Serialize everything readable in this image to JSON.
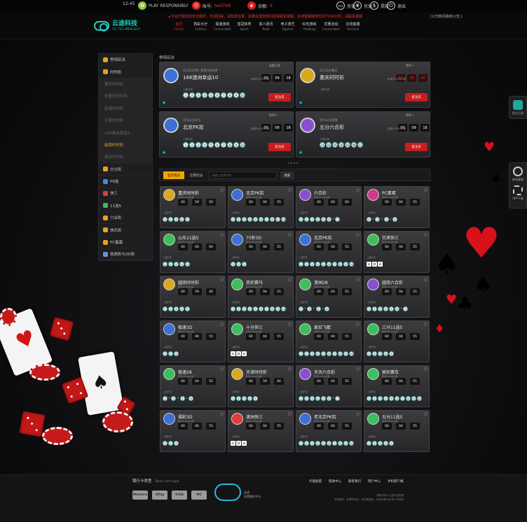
{
  "topbar": {
    "time": "12:45",
    "responsible": "PLAY RESPONSIBLY",
    "account_label": "账号:",
    "account_value": "test768",
    "balance_label": "余额:",
    "balance_value": "0",
    "actions": [
      "充值卡",
      "充值",
      "提款",
      "退出"
    ]
  },
  "header": {
    "marquee": "平台已经改善优化服务，欢迎回来，请玩家注意，如果充值发现问题请联系客服。在线客服服务时间7X24小时，请联系客服",
    "marquee_extra": "[公司新闻最新公告 ]",
    "logo_text": "云途科技",
    "logo_sub": "YG.TECHNOLOGY",
    "nav": [
      {
        "cn": "首页",
        "en": "Home"
      },
      {
        "cn": "购彩大厅",
        "en": "Lottery"
      },
      {
        "cn": "极速游戏",
        "en": "Favourable"
      },
      {
        "cn": "皇冠体育",
        "en": "Sport"
      },
      {
        "cn": "真人视讯",
        "en": "Real"
      },
      {
        "cn": "电子游艺",
        "en": "Egame"
      },
      {
        "cn": "红包游戏",
        "en": "Redbag"
      },
      {
        "cn": "优惠活动",
        "en": "Favourable"
      },
      {
        "cn": "在线客服",
        "en": "Service"
      }
    ]
  },
  "sidebar": {
    "items": [
      {
        "label": "常用玩法",
        "kind": "main",
        "color": "#e8a419"
      },
      {
        "label": "时时彩",
        "kind": "main",
        "color": "#e8a419"
      },
      {
        "label": "重庆时时彩",
        "kind": "sub"
      },
      {
        "label": "老重庆时时彩",
        "kind": "sub"
      },
      {
        "label": "新疆时时彩",
        "kind": "sub"
      },
      {
        "label": "天津时时彩",
        "kind": "sub"
      },
      {
        "label": "168澳洲幸运5",
        "kind": "sub"
      },
      {
        "label": "越南时时彩",
        "kind": "sub-active"
      },
      {
        "label": "澳洲时时彩",
        "kind": "sub"
      },
      {
        "label": "分分彩",
        "kind": "main",
        "color": "#e8a419"
      },
      {
        "label": "PK拾",
        "kind": "main",
        "color": "#3b8de0"
      },
      {
        "label": "快三",
        "kind": "main",
        "color": "#e23b3b"
      },
      {
        "label": "11选5",
        "kind": "main",
        "color": "#3bbf5a"
      },
      {
        "label": "六合彩",
        "kind": "main",
        "color": "#e8a419"
      },
      {
        "label": "快乐彩",
        "kind": "main",
        "color": "#e8a419"
      },
      {
        "label": "PC蛋蛋",
        "kind": "main",
        "color": "#e8a419"
      },
      {
        "label": "低频彩与3D彩",
        "kind": "main",
        "color": "#6b8fe0"
      }
    ]
  },
  "featured": {
    "title": "常用玩法",
    "cards": [
      {
        "sub": "官方玩法/第三期是开奖结果",
        "name": "168澳洲幸运10",
        "period": "上期开奖",
        "issue": "距离0000000期",
        "timer": [
          "00",
          "09",
          "18"
        ],
        "timer_red": false,
        "balls": [
          "1",
          "2",
          "3",
          "4",
          "5",
          "6",
          "7",
          "8",
          "9",
          "10"
        ],
        "sound": "无提示音",
        "bet": "投注去",
        "color": "#3c6fd8"
      },
      {
        "sub": "官方玩法/整点",
        "name": "重庆时时彩",
        "period": "上期开奖",
        "issue": "距离0000000期",
        "timer": [
          "00",
          "00",
          "00"
        ],
        "timer_red": true,
        "balls": [],
        "sound": "铃声一",
        "bet": "投注去",
        "color": "#d8a91c"
      },
      {
        "sub": "官方玩法/北京",
        "name": "北京PK拾",
        "period": "上期开奖",
        "issue": "距离0000000期",
        "timer": [
          "00",
          "09",
          "18"
        ],
        "timer_red": false,
        "balls": [
          "1",
          "2",
          "3",
          "4",
          "5",
          "6",
          "7",
          "8",
          "9",
          "10"
        ],
        "sound": "铃声二",
        "bet": "投注去",
        "color": "#3c6fd8"
      },
      {
        "sub": "官方玩法/香港",
        "name": "五分六合彩",
        "period": "上期开奖",
        "issue": "距离0000000期",
        "timer": [
          "00",
          "09",
          "18"
        ],
        "timer_red": false,
        "balls": [
          "31",
          "43",
          "05",
          "30",
          "03",
          "46",
          "13"
        ],
        "sound": "铃声一",
        "bet": "投注去",
        "color": "#8a4fd0"
      }
    ]
  },
  "tabs": {
    "official": "官方玩法",
    "credit": "信用玩法",
    "search_placeholder": "请输入彩票名称",
    "search_button": "搜索"
  },
  "games": [
    {
      "name": "重庆时时彩",
      "color": "#d8a91c",
      "t": [
        "40",
        "59",
        "50"
      ],
      "b": [
        "1",
        "2",
        "3",
        "4",
        "5"
      ],
      "type": "ball"
    },
    {
      "name": "北京PK拾",
      "color": "#3c6fd8",
      "t": [
        "00",
        "06",
        "55"
      ],
      "b": [
        "1",
        "2",
        "3",
        "4",
        "5",
        "6",
        "7",
        "8",
        "9",
        "10"
      ],
      "type": "ball"
    },
    {
      "name": "六合彩",
      "color": "#8a4fd0",
      "t": [
        "00",
        "00",
        "00"
      ],
      "b": [
        "1",
        "2",
        "3",
        "4",
        "5",
        "6",
        "+",
        "7"
      ],
      "type": "ball"
    },
    {
      "name": "PC蛋蛋",
      "color": "#cc3b8a",
      "t": [
        "00",
        "04",
        "55"
      ],
      "b": [
        "1",
        "+",
        "2",
        "+",
        "3",
        "=",
        "6"
      ],
      "type": "ball"
    },
    {
      "name": "山东11选5",
      "color": "#3bbf5a",
      "t": [
        "00",
        "00",
        "00"
      ],
      "b": [
        "1",
        "2",
        "3",
        "4",
        "5"
      ],
      "type": "ball"
    },
    {
      "name": "75秒3D",
      "color": "#3c6fd8",
      "t": [
        "00",
        "00",
        "55"
      ],
      "b": [
        "1",
        "2",
        "3"
      ],
      "type": "ball"
    },
    {
      "name": "北京PK拾",
      "color": "#3c6fd8",
      "t": [
        "00",
        "04",
        "55"
      ],
      "b": [
        "1",
        "2",
        "3",
        "4",
        "5",
        "6",
        "7",
        "8",
        "9",
        "10"
      ],
      "type": "ball"
    },
    {
      "name": "甘肃快三",
      "color": "#3bbf5a",
      "t": [
        "00",
        "04",
        "55"
      ],
      "b": [
        "⚀",
        "⚁",
        "⚂"
      ],
      "type": "dice"
    },
    {
      "name": "越南时时彩",
      "color": "#d8a91c",
      "t": [
        "00",
        "59",
        "40"
      ],
      "b": [
        "1",
        "2",
        "3",
        "4",
        "5"
      ],
      "type": "ball"
    },
    {
      "name": "英伦赛马",
      "color": "#3bbf5a",
      "t": [
        "00",
        "04",
        "55"
      ],
      "b": [
        "1",
        "2",
        "3",
        "4",
        "5",
        "6",
        "7",
        "8",
        "9",
        "10"
      ],
      "type": "ball"
    },
    {
      "name": "澳洲28",
      "color": "#3bbf5a",
      "t": [
        "00",
        "04",
        "55"
      ],
      "b": [
        "1",
        "+",
        "2",
        "+",
        "3",
        "=",
        "6"
      ],
      "type": "ball"
    },
    {
      "name": "越南六合彩",
      "color": "#8a4fd0",
      "t": [
        "00",
        "04",
        "55"
      ],
      "b": [
        "1",
        "2",
        "3",
        "4",
        "5",
        "6",
        "+",
        "7"
      ],
      "type": "ball"
    },
    {
      "name": "极速3D",
      "color": "#3c6fd8",
      "t": [
        "00",
        "06",
        "55"
      ],
      "b": [
        "1",
        "2",
        "3"
      ],
      "type": "ball"
    },
    {
      "name": "十分快三",
      "color": "#3bbf5a",
      "t": [
        "00",
        "04",
        "55"
      ],
      "b": [
        "⚀",
        "⚁",
        "⚂"
      ],
      "type": "dice"
    },
    {
      "name": "疯狂飞艇",
      "color": "#3bbf5a",
      "t": [
        "00",
        "04",
        "55"
      ],
      "b": [
        "1",
        "2",
        "3",
        "4",
        "5",
        "6",
        "7",
        "8",
        "9",
        "10"
      ],
      "type": "ball"
    },
    {
      "name": "三分11选5",
      "color": "#3bbf5a",
      "t": [
        "00",
        "04",
        "55"
      ],
      "b": [
        "1",
        "2",
        "3",
        "4",
        "5"
      ],
      "type": "ball"
    },
    {
      "name": "极速28",
      "color": "#3bbf5a",
      "t": [
        "00",
        "04",
        "55"
      ],
      "b": [
        "1",
        "+",
        "2",
        "+",
        "3",
        "=",
        "6"
      ],
      "type": "ball"
    },
    {
      "name": "天津时时彩",
      "color": "#d8a91c",
      "t": [
        "00",
        "59",
        "40"
      ],
      "b": [
        "1",
        "2",
        "3",
        "4",
        "5"
      ],
      "type": "ball"
    },
    {
      "name": "天天六合彩",
      "color": "#8a4fd0",
      "t": [
        "00",
        "04",
        "55"
      ],
      "b": [
        "1",
        "2",
        "3",
        "4",
        "5",
        "6",
        "+",
        "7"
      ],
      "type": "ball"
    },
    {
      "name": "疯狂赛车",
      "color": "#3bbf5a",
      "t": [
        "00",
        "04",
        "55"
      ],
      "b": [
        "1",
        "2",
        "3",
        "4",
        "5",
        "6",
        "7",
        "8",
        "9",
        "10"
      ],
      "type": "ball"
    },
    {
      "name": "福彩3D",
      "color": "#3c6fd8",
      "t": [
        "00",
        "06",
        "55"
      ],
      "b": [
        "1",
        "2",
        "3"
      ],
      "type": "ball"
    },
    {
      "name": "澳洲快三",
      "color": "#e23b3b",
      "t": [
        "00",
        "04",
        "55"
      ],
      "b": [
        "⚀",
        "⚁",
        "⚂"
      ],
      "type": "dice"
    },
    {
      "name": "老北京PK拾",
      "color": "#3c6fd8",
      "t": [
        "00",
        "04",
        "55"
      ],
      "b": [
        "1",
        "2",
        "3",
        "4",
        "5",
        "6",
        "7",
        "8",
        "9",
        "10"
      ],
      "type": "ball"
    },
    {
      "name": "五分11选5",
      "color": "#3bbf5a",
      "t": [
        "00",
        "04",
        "55"
      ],
      "b": [
        "1",
        "2",
        "3",
        "4",
        "5"
      ],
      "type": "ball"
    }
  ],
  "game_labels": {
    "issue": "距离0000000期",
    "period": "上期开奖"
  },
  "right_float": {
    "record": "投注记录",
    "service": "联系客服",
    "app": "APP下载"
  },
  "footer": {
    "bank_title": "银行卡类型",
    "bank_title_en": "Bank card type",
    "cards": [
      "Maestro",
      "GPay",
      "VISA",
      "MC"
    ],
    "cloud_text_1": "云途",
    "cloud_text_2": "彩票服务平台",
    "links": [
      "代理加盟",
      "帮助中心",
      "联系我们",
      "用户中心",
      "手机客户端"
    ],
    "copyright_1": "版权所有©云途科技彩票",
    "copyright_2": "彩票服务，彩票有风险，投注需谨慎，不向未满18岁青少年售彩"
  }
}
